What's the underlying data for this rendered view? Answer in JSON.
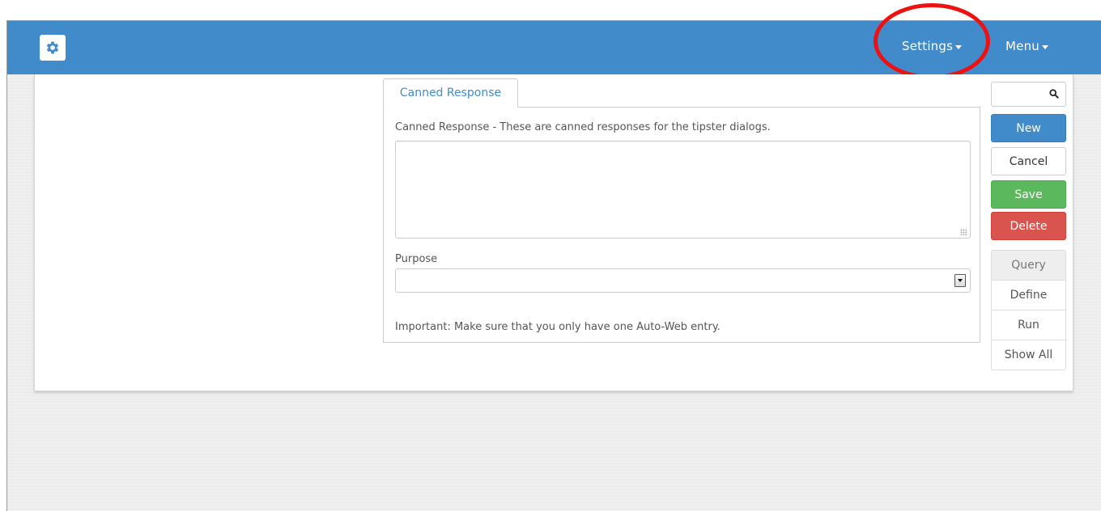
{
  "navbar": {
    "logo_icon": "gear-icon",
    "settings_label": "Settings",
    "menu_label": "Menu",
    "color": "#428bca",
    "highlight_color": "#ee1111"
  },
  "tab": {
    "label": "Canned Response"
  },
  "form": {
    "description": "Canned Response - These are canned responses for the tipster dialogs.",
    "response_value": "",
    "purpose_label": "Purpose",
    "purpose_selected": "",
    "note": "Important: Make sure that you only have one Auto-Web entry."
  },
  "sidebar": {
    "search_placeholder": "",
    "search_icon": "search-icon",
    "new_label": "New",
    "cancel_label": "Cancel",
    "save_label": "Save",
    "delete_label": "Delete",
    "query_group": [
      "Query",
      "Define",
      "Run",
      "Show All"
    ],
    "colors": {
      "new": "#428bca",
      "save": "#5cb85c",
      "delete": "#d9534f"
    }
  }
}
